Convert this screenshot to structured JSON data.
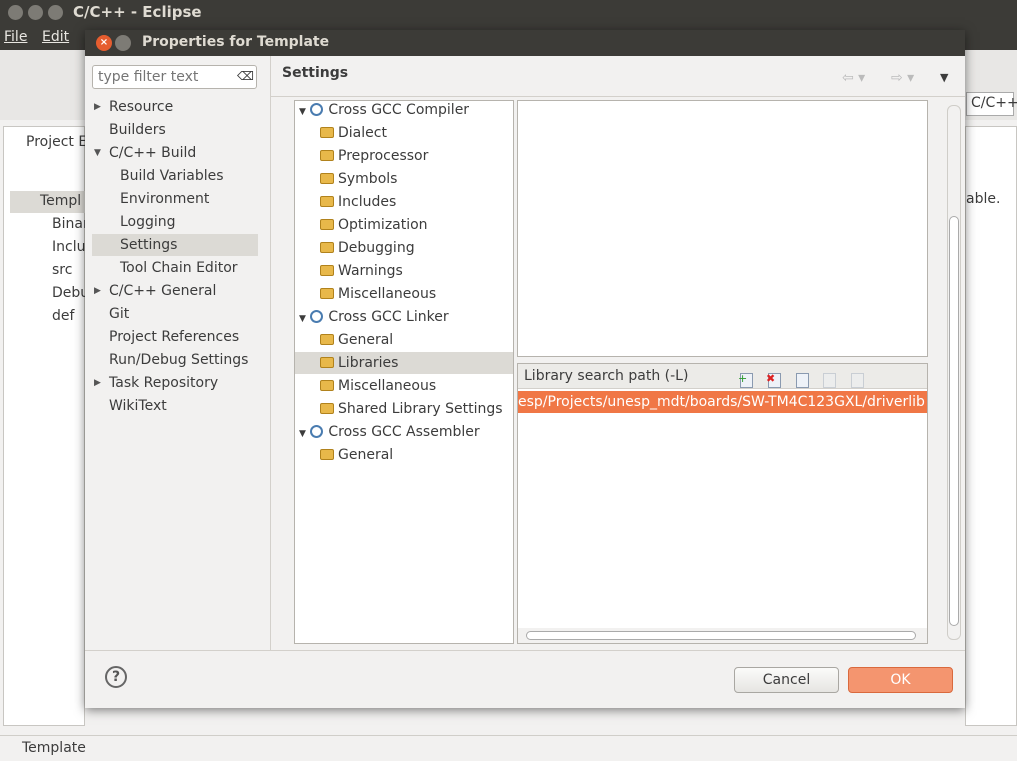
{
  "window": {
    "title": "C/C++ - Eclipse",
    "menu": [
      "File",
      "Edit"
    ],
    "perspective": "C/C++",
    "right_text": "able.",
    "status": "Template"
  },
  "project_explorer": {
    "title": "Project E",
    "items": [
      "Templ",
      "Binar",
      "Inclu",
      "src",
      "Debu",
      "def"
    ]
  },
  "dialog": {
    "title": "Properties for Template",
    "filter_placeholder": "type filter text",
    "header": "Settings",
    "nav": [
      {
        "label": "Resource",
        "level": 0,
        "arrow": "right"
      },
      {
        "label": "Builders",
        "level": 0
      },
      {
        "label": "C/C++ Build",
        "level": 0,
        "arrow": "down"
      },
      {
        "label": "Build Variables",
        "level": 1
      },
      {
        "label": "Environment",
        "level": 1
      },
      {
        "label": "Logging",
        "level": 1
      },
      {
        "label": "Settings",
        "level": 1,
        "selected": true
      },
      {
        "label": "Tool Chain Editor",
        "level": 1
      },
      {
        "label": "C/C++ General",
        "level": 0,
        "arrow": "right"
      },
      {
        "label": "Git",
        "level": 0
      },
      {
        "label": "Project References",
        "level": 0
      },
      {
        "label": "Run/Debug Settings",
        "level": 0
      },
      {
        "label": "Task Repository",
        "level": 0,
        "arrow": "right"
      },
      {
        "label": "WikiText",
        "level": 0
      }
    ],
    "tree": [
      {
        "label": "Cross GCC Compiler",
        "tool": true
      },
      {
        "label": "Dialect"
      },
      {
        "label": "Preprocessor"
      },
      {
        "label": "Symbols"
      },
      {
        "label": "Includes"
      },
      {
        "label": "Optimization"
      },
      {
        "label": "Debugging"
      },
      {
        "label": "Warnings"
      },
      {
        "label": "Miscellaneous"
      },
      {
        "label": "Cross GCC Linker",
        "tool": true
      },
      {
        "label": "General"
      },
      {
        "label": "Libraries",
        "selected": true
      },
      {
        "label": "Miscellaneous"
      },
      {
        "label": "Shared Library Settings"
      },
      {
        "label": "Cross GCC Assembler",
        "tool": true
      },
      {
        "label": "General"
      }
    ],
    "lib_panel": {
      "label": "Library search path (-L)",
      "icons": [
        "add-icon",
        "delete-icon",
        "edit-icon",
        "move-up-icon",
        "move-down-icon"
      ],
      "entries": [
        "esp/Projects/unesp_mdt/boards/SW-TM4C123GXL/driverlib"
      ]
    },
    "buttons": {
      "help": "?",
      "cancel": "Cancel",
      "ok": "OK"
    },
    "colors": {
      "selection": "#f07746",
      "ok_button": "#f4956f"
    }
  }
}
